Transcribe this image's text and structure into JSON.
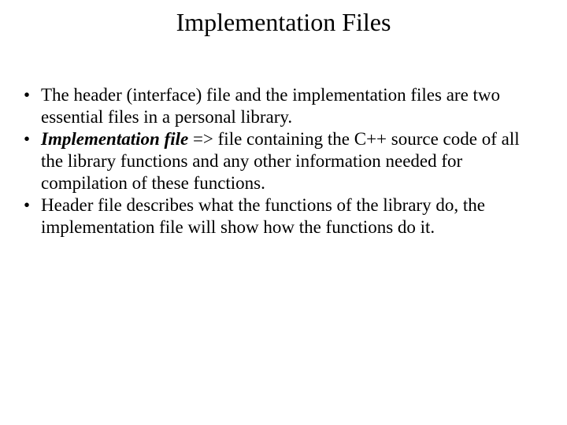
{
  "title": "Implementation Files",
  "bullets": {
    "b0": "The header (interface) file and the implementation files are two essential files in a personal library.",
    "b1_emph": "Implementation file",
    "b1_rest": " => file containing the C++ source code of all the library functions and any other information needed for compilation of these functions.",
    "b2": "Header file describes what the functions of the library do, the implementation file will show how the functions do it."
  }
}
